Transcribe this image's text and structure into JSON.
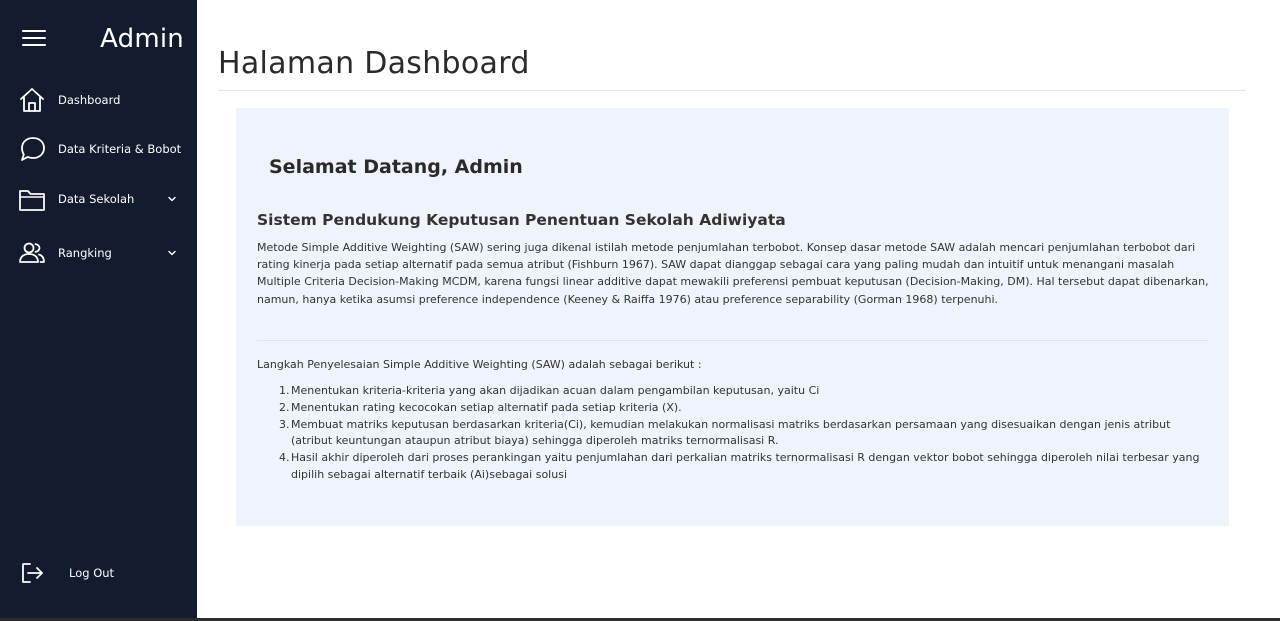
{
  "sidebar": {
    "brand": "Admin",
    "items": [
      {
        "label": "Dashboard",
        "icon": "home-icon"
      },
      {
        "label": "Data Kriteria & Bobot",
        "icon": "chat-bubble-icon"
      },
      {
        "label": "Data Sekolah",
        "icon": "folder-icon",
        "has_submenu": true
      },
      {
        "label": "Rangking",
        "icon": "users-icon",
        "has_submenu": true
      }
    ],
    "logout": {
      "label": "Log Out",
      "icon": "logout-icon"
    }
  },
  "main": {
    "page_title": "Halaman Dashboard",
    "welcome": "Selamat Datang, Admin",
    "subtitle": "Sistem Pendukung Keputusan Penentuan Sekolah Adiwiyata",
    "paragraph": "Metode Simple Additive Weighting (SAW) sering juga dikenal istilah metode penjumlahan terbobot. Konsep dasar metode SAW adalah mencari penjumlahan terbobot dari rating kinerja pada setiap alternatif pada semua atribut (Fishburn 1967). SAW dapat dianggap sebagai cara yang paling mudah dan intuitif untuk menangani masalah Multiple Criteria Decision-Making MCDM, karena fungsi linear additive dapat mewakili preferensi pembuat keputusan (Decision-Making, DM). Hal tersebut dapat dibenarkan, namun, hanya ketika asumsi preference independence (Keeney & Raiffa 1976) atau preference separability (Gorman 1968) terpenuhi.",
    "steps_intro": "Langkah Penyelesaian Simple Additive Weighting (SAW) adalah sebagai berikut :",
    "steps": [
      "Menentukan kriteria-kriteria yang akan dijadikan acuan dalam pengambilan keputusan, yaitu Ci",
      "Menentukan rating kecocokan setiap alternatif pada setiap kriteria (X).",
      "Membuat matriks keputusan berdasarkan kriteria(Ci), kemudian melakukan normalisasi matriks berdasarkan persamaan yang disesuaikan dengan jenis atribut (atribut keuntungan ataupun atribut biaya) sehingga diperoleh matriks ternormalisasi R.",
      "Hasil akhir diperoleh dari proses perankingan yaitu penjumlahan dari perkalian matriks ternormalisasi R dengan vektor bobot sehingga diperoleh nilai terbesar yang dipilih sebagai alternatif terbaik (Ai)sebagai solusi"
    ]
  },
  "colors": {
    "sidebar_bg": "#131b2e",
    "card_bg": "#eff4fc",
    "text": "#333333"
  }
}
